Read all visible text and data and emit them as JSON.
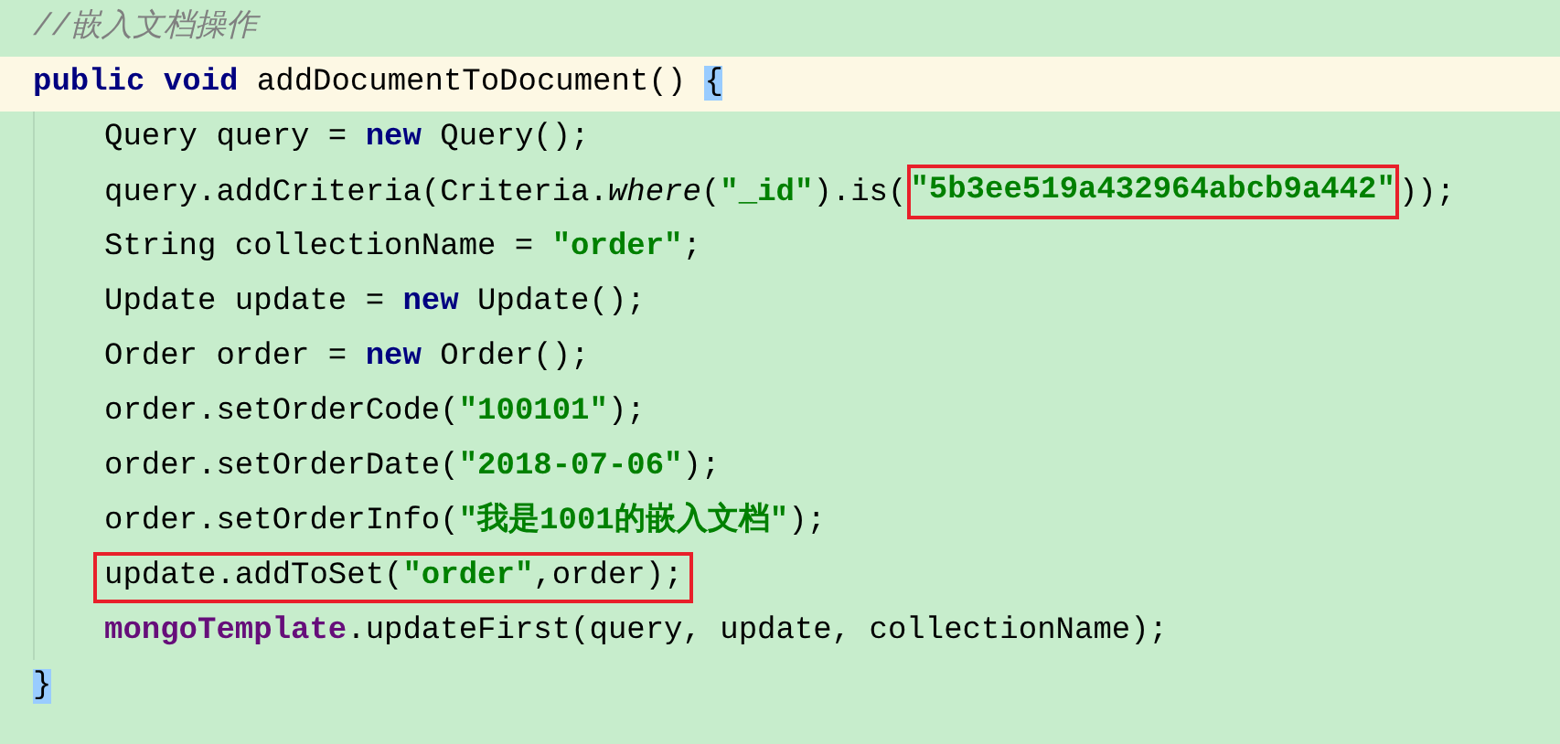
{
  "comment": "//嵌入文档操作",
  "method": {
    "current": true,
    "signature": [
      {
        "kind": "keyword",
        "text": "public void "
      },
      {
        "kind": "plain",
        "text": "addDocumentToDocument() "
      },
      {
        "kind": "brace_match",
        "text": "{"
      }
    ],
    "body": [
      {
        "boxed": false,
        "tokens": [
          {
            "kind": "plain",
            "text": "Query query = "
          },
          {
            "kind": "keyword",
            "text": "new "
          },
          {
            "kind": "plain",
            "text": "Query();"
          }
        ]
      },
      {
        "boxed": false,
        "tokens": [
          {
            "kind": "plain",
            "text": "query.addCriteria(Criteria."
          },
          {
            "kind": "static",
            "text": "where"
          },
          {
            "kind": "plain",
            "text": "("
          },
          {
            "kind": "string",
            "text": "\"_id\""
          },
          {
            "kind": "plain",
            "text": ").is("
          },
          {
            "kind": "boxed_string",
            "text": "\"5b3ee519a432964abcb9a442\""
          },
          {
            "kind": "plain",
            "text": "));"
          }
        ]
      },
      {
        "boxed": false,
        "tokens": [
          {
            "kind": "plain",
            "text": "String collectionName = "
          },
          {
            "kind": "string",
            "text": "\"order\""
          },
          {
            "kind": "plain",
            "text": ";"
          }
        ]
      },
      {
        "boxed": false,
        "tokens": [
          {
            "kind": "plain",
            "text": "Update update = "
          },
          {
            "kind": "keyword",
            "text": "new "
          },
          {
            "kind": "plain",
            "text": "Update();"
          }
        ]
      },
      {
        "boxed": false,
        "tokens": [
          {
            "kind": "plain",
            "text": "Order order = "
          },
          {
            "kind": "keyword",
            "text": "new "
          },
          {
            "kind": "plain",
            "text": "Order();"
          }
        ]
      },
      {
        "boxed": false,
        "tokens": [
          {
            "kind": "plain",
            "text": "order.setOrderCode("
          },
          {
            "kind": "string",
            "text": "\"100101\""
          },
          {
            "kind": "plain",
            "text": ");"
          }
        ]
      },
      {
        "boxed": false,
        "tokens": [
          {
            "kind": "plain",
            "text": "order.setOrderDate("
          },
          {
            "kind": "string",
            "text": "\"2018-07-06\""
          },
          {
            "kind": "plain",
            "text": ");"
          }
        ]
      },
      {
        "boxed": false,
        "tokens": [
          {
            "kind": "plain",
            "text": "order.setOrderInfo("
          },
          {
            "kind": "string",
            "text": "\"我是1001的嵌入文档\""
          },
          {
            "kind": "plain",
            "text": ");"
          }
        ]
      },
      {
        "boxed": true,
        "tokens": [
          {
            "kind": "plain",
            "text": "update.addToSet("
          },
          {
            "kind": "string",
            "text": "\"order\""
          },
          {
            "kind": "plain",
            "text": ",order);"
          }
        ]
      },
      {
        "boxed": false,
        "tokens": [
          {
            "kind": "field",
            "text": "mongoTemplate"
          },
          {
            "kind": "plain",
            "text": ".updateFirst(query, update, collectionName);"
          }
        ]
      }
    ],
    "closing": [
      {
        "kind": "brace_match",
        "text": "}"
      }
    ]
  }
}
